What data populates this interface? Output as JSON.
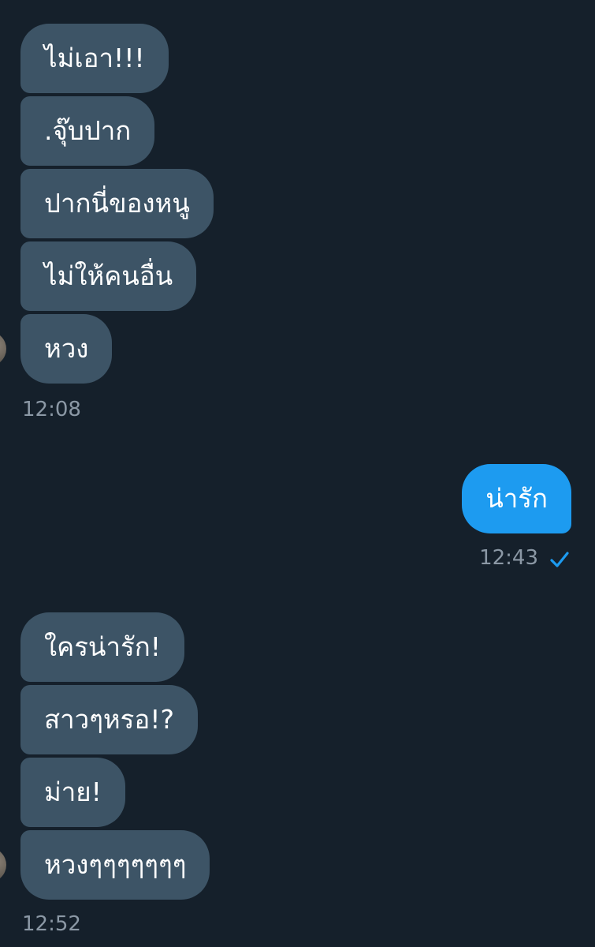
{
  "conversation": {
    "group1": {
      "messages": [
        {
          "text": "ไม่เอา!!!"
        },
        {
          "text": ".จุ๊บปาก"
        },
        {
          "text": "ปากนี่ของหนู"
        },
        {
          "text": "ไม่ให้คนอื่น"
        },
        {
          "text": "หวง"
        }
      ],
      "time": "12:08"
    },
    "group2": {
      "messages": [
        {
          "text": "น่ารัก"
        }
      ],
      "time": "12:43",
      "status_icon": "check-icon"
    },
    "group3": {
      "messages": [
        {
          "text": "ใครน่ารัก!"
        },
        {
          "text": "สาวๆหรอ!?"
        },
        {
          "text": "ม่าย!"
        },
        {
          "text": "หวงๆๆๆๆๆๆๆ"
        }
      ],
      "time": "12:52"
    }
  },
  "colors": {
    "background": "#15202b",
    "incoming_bubble": "#3d5466",
    "outgoing_bubble": "#1d9bf0",
    "timestamp": "#8b98a5",
    "check": "#1d9bf0"
  }
}
